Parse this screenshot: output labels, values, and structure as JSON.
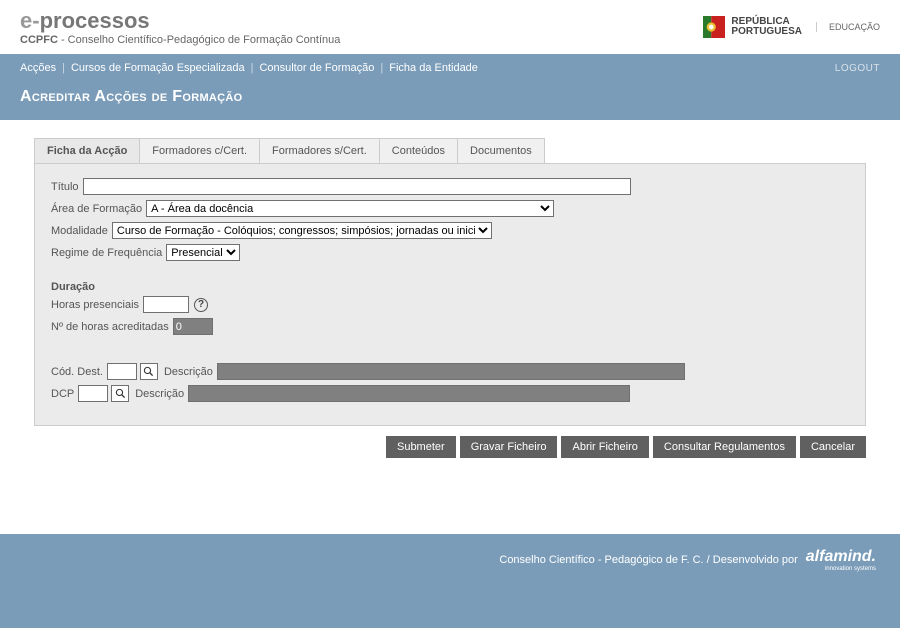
{
  "header": {
    "logo_prefix": "e-",
    "logo_main": "processos",
    "sub_bold": "CCPFC",
    "sub_rest": " - Conselho Científico-Pedagógico de Formação Contínua",
    "rp_line1": "REPÚBLICA",
    "rp_line2": "PORTUGUESA",
    "edu": "EDUCAÇÃO"
  },
  "nav": {
    "items": [
      "Acções",
      "Cursos de Formação Especializada",
      "Consultor de Formação",
      "Ficha da Entidade"
    ],
    "logout": "LOGOUT"
  },
  "page": {
    "title": "Acreditar Acções de Formação"
  },
  "tabs": [
    {
      "label": "Ficha da Acção"
    },
    {
      "label": "Formadores c/Cert."
    },
    {
      "label": "Formadores s/Cert."
    },
    {
      "label": "Conteúdos"
    },
    {
      "label": "Documentos"
    }
  ],
  "form": {
    "titulo_label": "Título",
    "titulo_value": "",
    "area_label": "Área de Formação",
    "area_value": "A - Área da docência",
    "modalidade_label": "Modalidade",
    "modalidade_value": "Curso de Formação - Colóquios; congressos; simpósios; jornadas ou iniciativas congéneres",
    "regime_label": "Regime de Frequência",
    "regime_value": "Presencial",
    "duracao_title": "Duração",
    "horas_pres_label": "Horas presenciais",
    "horas_pres_value": "",
    "horas_acred_label": "Nº de horas acreditadas",
    "horas_acred_value": "0",
    "cod_dest_label": "Cód. Dest.",
    "cod_dest_value": "",
    "descricao_label": "Descrição",
    "cod_dest_desc": "",
    "dcp_label": "DCP",
    "dcp_value": "",
    "dcp_desc": ""
  },
  "buttons": {
    "submit": "Submeter",
    "save": "Gravar Ficheiro",
    "open": "Abrir Ficheiro",
    "consult": "Consultar Regulamentos",
    "cancel": "Cancelar"
  },
  "footer": {
    "text": "Conselho Científico - Pedagógico de F. C.  /  Desenvolvido por",
    "brand": "alfamind.",
    "brand_sub": "innovation systems"
  }
}
